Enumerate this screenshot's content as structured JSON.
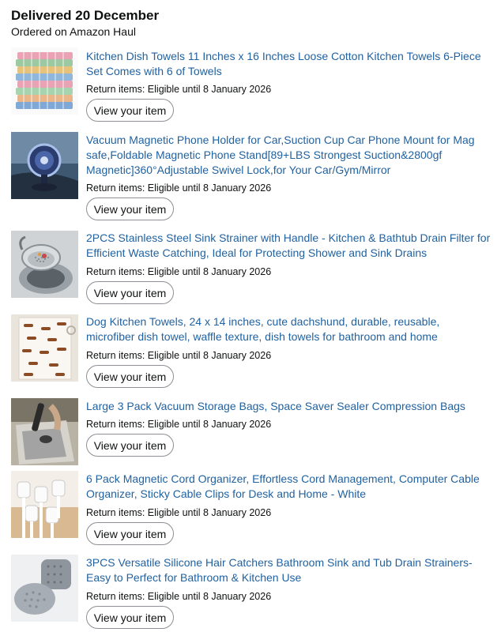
{
  "header": {
    "title": "Delivered 20 December",
    "subtitle": "Ordered on Amazon Haul"
  },
  "button_label": "View your item",
  "items": [
    {
      "title": "Kitchen Dish Towels 11 Inches x 16 Inches Loose Cotton Kitchen Towels 6-Piece Set Comes with 6 of Towels",
      "return_text": "Return items: Eligible until 8 January 2026",
      "thumb": "stacked-towels-image"
    },
    {
      "title": "Vacuum Magnetic Phone Holder for Car,Suction Cup Car Phone Mount for Mag safe,Foldable Magnetic Phone Stand[89+LBS Strongest Suction&2800gf Magnetic]360°Adjustable Swivel Lock,for Your Car/Gym/Mirror",
      "return_text": "Return items: Eligible until 8 January 2026",
      "thumb": "phone-holder-image"
    },
    {
      "title": "2PCS Stainless Steel Sink Strainer with Handle - Kitchen & Bathtub Drain Filter for Efficient Waste Catching, Ideal for Protecting Shower and Sink Drains",
      "return_text": "Return items: Eligible until 8 January 2026",
      "thumb": "sink-strainer-image"
    },
    {
      "title": "Dog Kitchen Towels, 24 x 14 inches, cute dachshund, durable, reusable, microfiber dish towel, waffle texture, dish towels for bathroom and home",
      "return_text": "Return items: Eligible until 8 January 2026",
      "thumb": "dachshund-towel-image"
    },
    {
      "title": "Large 3 Pack Vacuum Storage Bags, Space Saver Sealer Compression Bags",
      "return_text": "Return items: Eligible until 8 January 2026",
      "thumb": "vacuum-bag-image"
    },
    {
      "title": "6 Pack Magnetic Cord Organizer, Effortless Cord Management, Computer Cable Organizer, Sticky Cable Clips for Desk and Home - White",
      "return_text": "Return items: Eligible until 8 January 2026",
      "thumb": "cable-clips-image"
    },
    {
      "title": "3PCS Versatile Silicone Hair Catchers Bathroom Sink and Tub Drain Strainers- Easy to Perfect for Bathroom & Kitchen Use",
      "return_text": "Return items: Eligible until 8 January 2026",
      "thumb": "hair-catcher-image"
    }
  ]
}
